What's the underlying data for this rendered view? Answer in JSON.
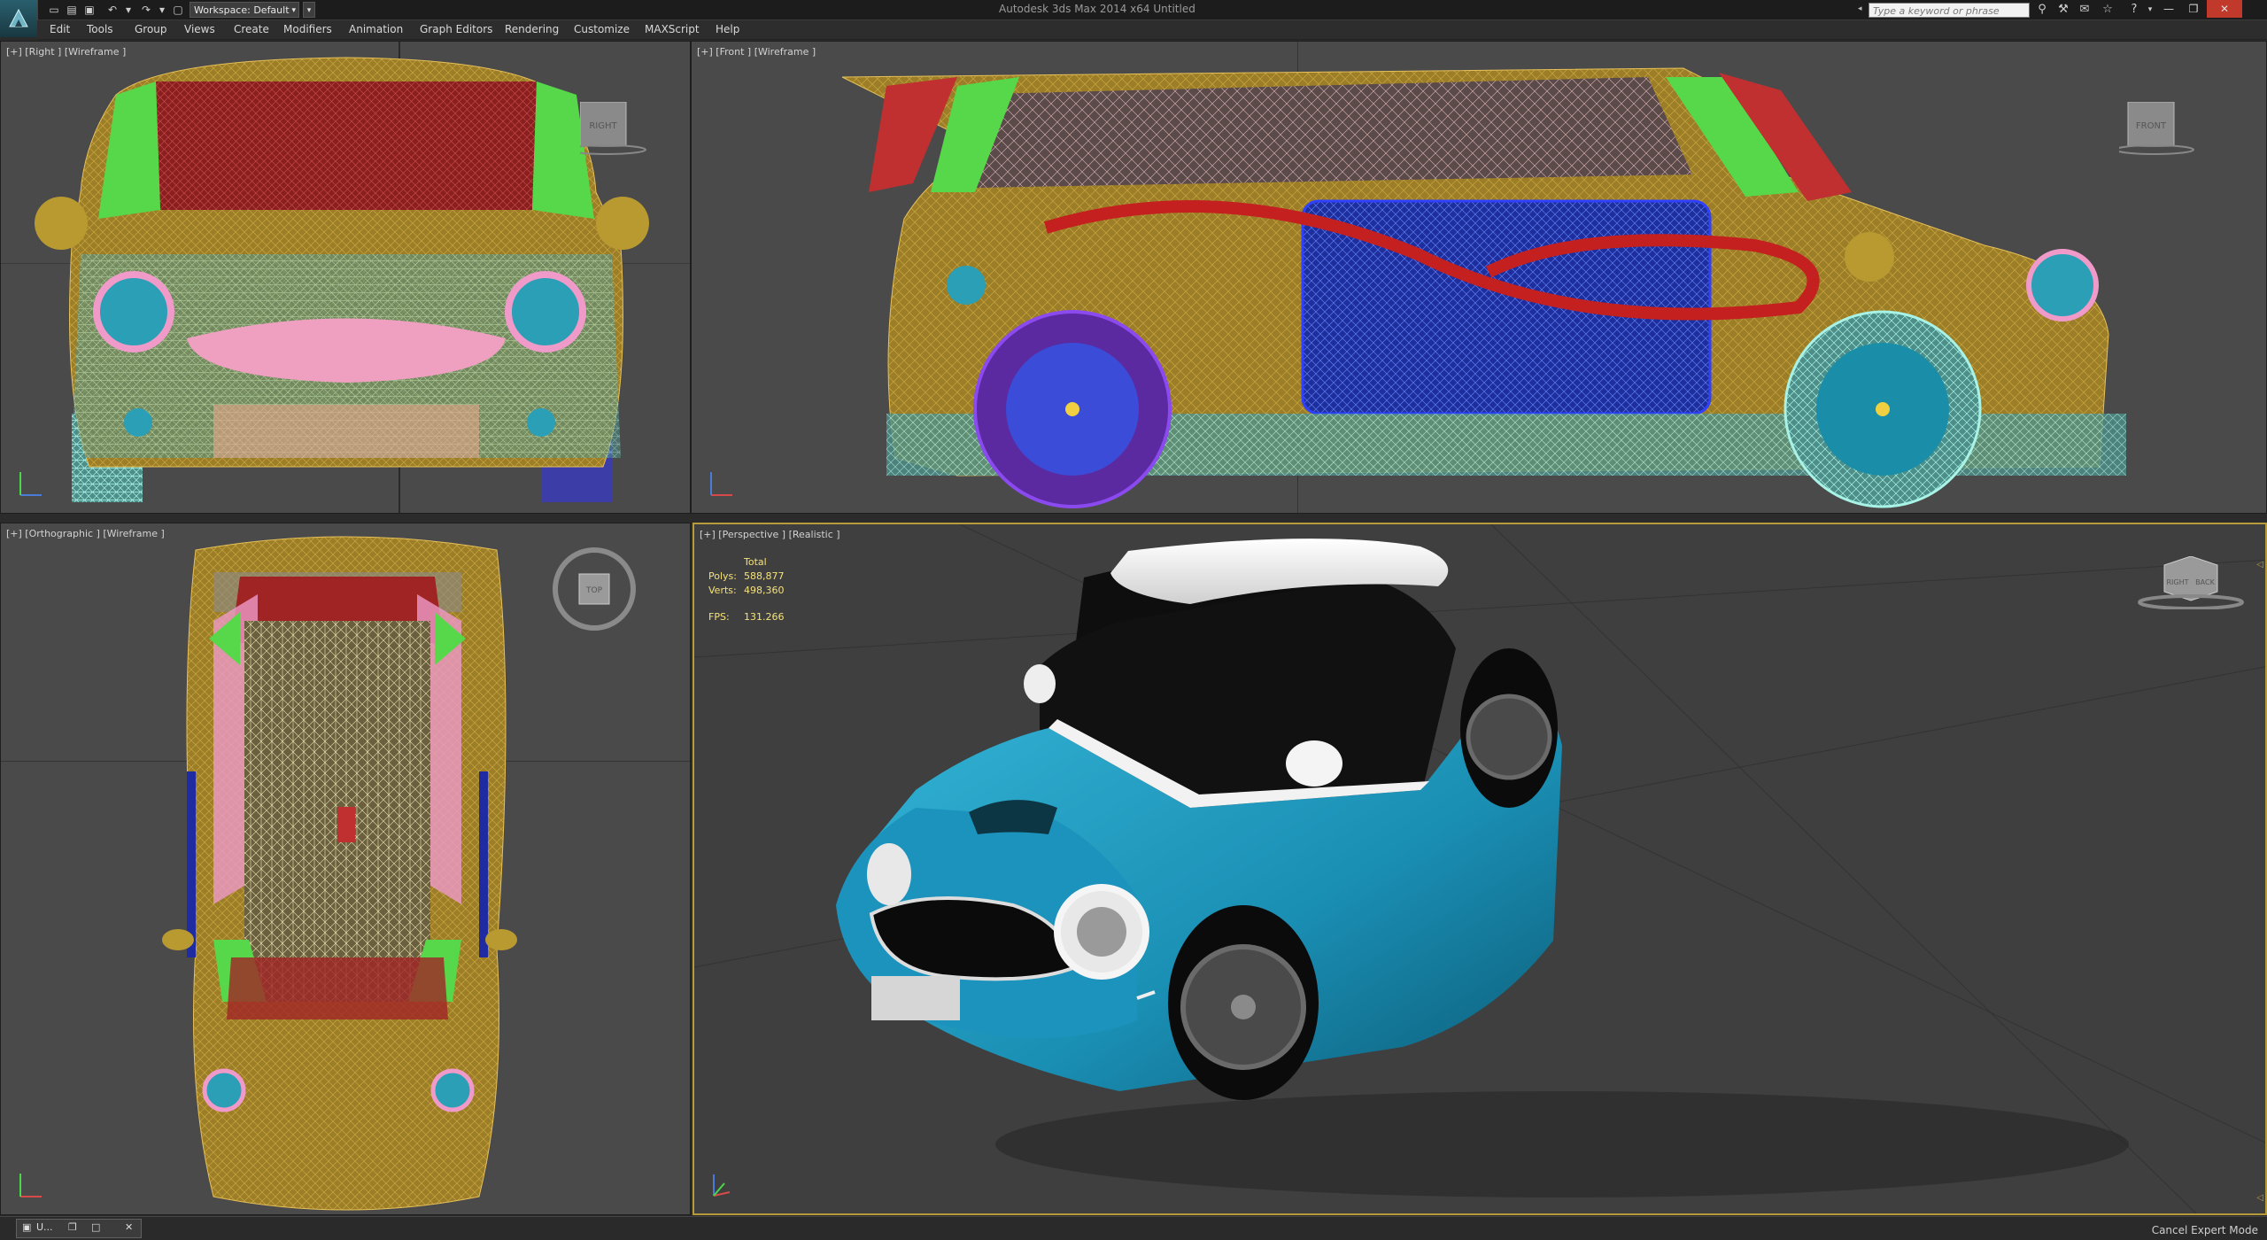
{
  "app": {
    "title": "Autodesk 3ds Max  2014 x64      Untitled",
    "workspace_label": "Workspace: Default",
    "search_placeholder": "Type a keyword or phrase"
  },
  "menu": [
    "Edit",
    "Tools",
    "Group",
    "Views",
    "Create",
    "Modifiers",
    "Animation",
    "Graph Editors",
    "Rendering",
    "Customize",
    "MAXScript",
    "Help"
  ],
  "viewports": {
    "right": {
      "label": "[+] [Right ] [Wireframe ]",
      "cube": "RIGHT"
    },
    "front": {
      "label": "[+] [Front ] [Wireframe ]",
      "cube": "FRONT"
    },
    "ortho": {
      "label": "[+] [Orthographic ] [Wireframe ]",
      "cube": "TOP"
    },
    "persp": {
      "label": "[+] [Perspective ] [Realistic ]",
      "cube_left": "RIGHT",
      "cube_right": "BACK"
    }
  },
  "stats": {
    "header": "Total",
    "polys_label": "Polys:",
    "polys_value": "588,877",
    "verts_label": "Verts:",
    "verts_value": "498,360",
    "fps_label": "FPS:",
    "fps_value": "131.266"
  },
  "status": {
    "task_label": "U...",
    "expert_mode": "Cancel Expert Mode"
  },
  "colors": {
    "viewport_bg": "#4a4a4a",
    "active_border": "#b79a3a",
    "car_body": "#1e98bd",
    "wire_gold": "#b8962e",
    "wire_cyan": "#7fe8d8"
  }
}
